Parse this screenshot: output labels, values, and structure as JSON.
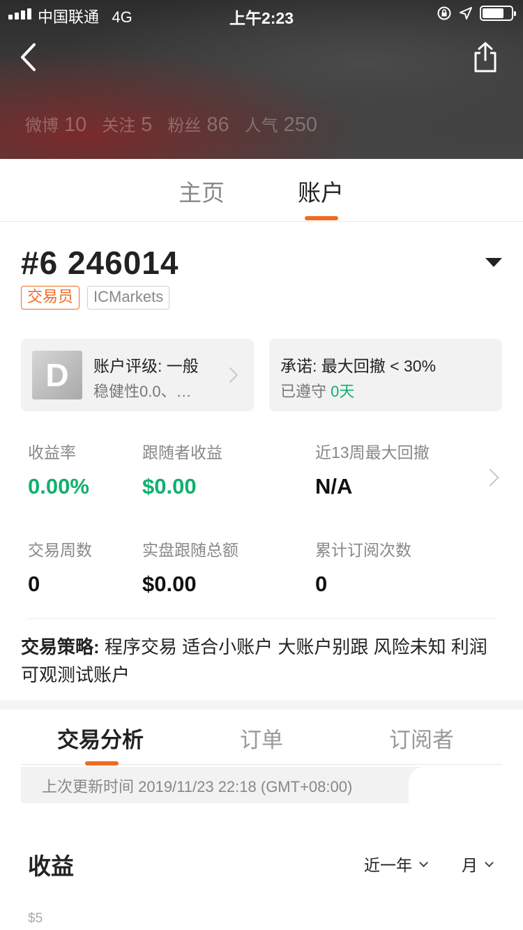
{
  "status_bar": {
    "carrier": "中国联通",
    "network": "4G",
    "time": "上午2:23"
  },
  "profile": {
    "stats": [
      {
        "label": "微博",
        "value": "10"
      },
      {
        "label": "关注",
        "value": "5"
      },
      {
        "label": "粉丝",
        "value": "86"
      },
      {
        "label": "人气",
        "value": "250"
      }
    ]
  },
  "profile_tabs": [
    {
      "label": "主页",
      "active": false
    },
    {
      "label": "账户",
      "active": true
    }
  ],
  "account": {
    "id": "#6 246014",
    "tags": [
      "交易员",
      "ICMarkets"
    ]
  },
  "rating_card": {
    "grade": "D",
    "title": "账户评级: 一般",
    "subtitle": "稳健性0.0、…"
  },
  "promise_card": {
    "title": "承诺: 最大回撤 < 30%",
    "sub_prefix": "已遵守",
    "sub_value": "0天"
  },
  "metrics": [
    {
      "label": "收益率",
      "value": "0.00%"
    },
    {
      "label": "跟随者收益",
      "value": "$0.00"
    },
    {
      "label": "近13周最大回撤",
      "value": "N/A"
    },
    {
      "label": "交易周数",
      "value": "0"
    },
    {
      "label": "实盘跟随总额",
      "value": "$0.00"
    },
    {
      "label": "累计订阅次数",
      "value": "0"
    }
  ],
  "strategy": {
    "label": "交易策略:",
    "text": "程序交易 适合小账户 大账户别跟 风险未知 利润可观测试账户"
  },
  "analysis_tabs": [
    {
      "label": "交易分析",
      "active": true
    },
    {
      "label": "订单",
      "active": false
    },
    {
      "label": "订阅者",
      "active": false
    }
  ],
  "last_updated": "上次更新时间 2019/11/23 22:18 (GMT+08:00)",
  "earnings": {
    "title": "收益",
    "range_select": "近一年",
    "period_select": "月",
    "y_tick": "$5"
  },
  "colors": {
    "accent": "#f06a20",
    "positive": "#10b06e"
  }
}
